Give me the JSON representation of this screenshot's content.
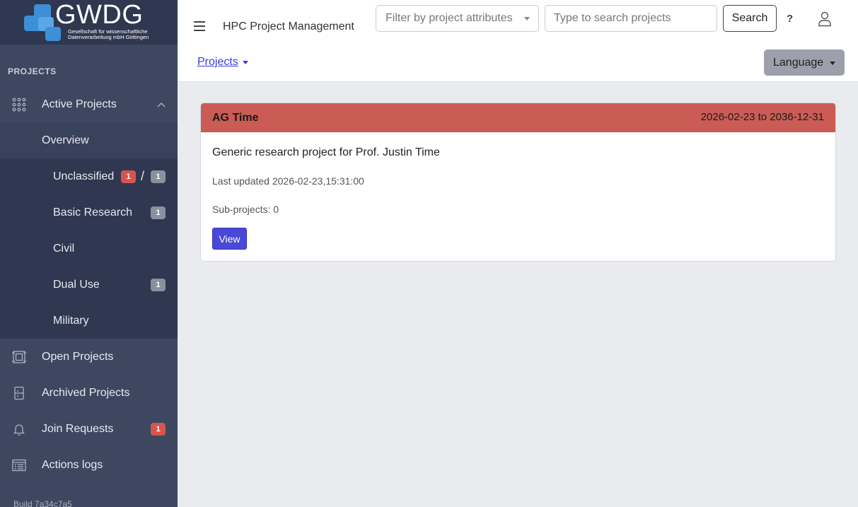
{
  "brand": {
    "logo_text": "GWDG",
    "logo_subtitle": "Gesellschaft für wissenschaftliche Datenverarbeitung mbH Göttingen"
  },
  "sidebar": {
    "section_title": "PROJECTS",
    "active_projects": {
      "label": "Active Projects",
      "icon": "grid-dots-icon",
      "expanded": true
    },
    "sub_items": {
      "overview": {
        "label": "Overview"
      },
      "unclassified": {
        "label": "Unclassified",
        "badge_red": "1",
        "separator": "/",
        "badge_grey": "1"
      },
      "basic_research": {
        "label": "Basic Research",
        "badge_grey": "1"
      },
      "civil": {
        "label": "Civil"
      },
      "dual_use": {
        "label": "Dual Use",
        "badge_grey": "1"
      },
      "military": {
        "label": "Military"
      }
    },
    "open_projects": {
      "label": "Open Projects",
      "icon": "frame-icon"
    },
    "archived_projects": {
      "label": "Archived Projects",
      "icon": "cabinet-icon"
    },
    "join_requests": {
      "label": "Join Requests",
      "icon": "bell-icon",
      "badge_red": "1"
    },
    "actions_logs": {
      "label": "Actions logs",
      "icon": "list-icon"
    },
    "build": "Build 7a34c7a5"
  },
  "header": {
    "app_title": "HPC Project Management",
    "filter_placeholder": "Filter by project attributes",
    "search_placeholder": "Type to search projects",
    "search_label": "Search",
    "help_label": "?",
    "projects_link": "Projects",
    "language_label": "Language"
  },
  "project_card": {
    "title": "AG Time",
    "dates": "2026-02-23 to 2036-12-31",
    "description": "Generic research project for Prof. Justin Time",
    "last_updated": "Last updated 2026-02-23,15:31:00",
    "sub_projects": "Sub-projects: 0",
    "view_label": "View",
    "header_color": "#cb5c55"
  },
  "colors": {
    "sidebar": "#3d4860",
    "sidebar_sub": "#2f3850",
    "accent": "#4a48d8",
    "badge_red": "#d9534f",
    "badge_grey": "#8a919e"
  }
}
